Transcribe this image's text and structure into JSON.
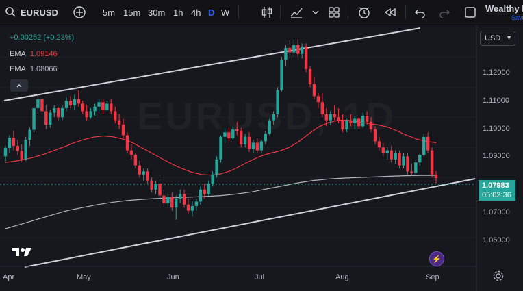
{
  "toolbar": {
    "symbol": "EURUSD",
    "intervals": [
      "5m",
      "15m",
      "30m",
      "1h",
      "4h",
      "D",
      "W"
    ],
    "active_interval": "D",
    "account_name": "Wealthy I",
    "account_sub": "Save"
  },
  "legend": {
    "change": "+0.00252 (+0.23%)",
    "change_color": "#26a69a",
    "ema1_label": "EMA",
    "ema1_value": "1.09146",
    "ema1_color": "#f23645",
    "ema2_label": "EMA",
    "ema2_value": "1.08066",
    "ema2_color": "#b2b5be"
  },
  "currency_select": "USD",
  "watermark": "EURUSD, 1D",
  "price_axis": {
    "ticks": [
      "1.12000",
      "1.11000",
      "1.10000",
      "1.09000",
      "1.07000",
      "1.06000"
    ],
    "current_price": "1.07983",
    "countdown": "05:02:36",
    "current_color": "#26a69a"
  },
  "time_axis": {
    "ticks": [
      "Apr",
      "May",
      "Jun",
      "Jul",
      "Aug",
      "Sep"
    ]
  },
  "chart_data": {
    "type": "candlestick",
    "ohlc": [
      [
        1.087,
        1.0905,
        1.085,
        1.0898
      ],
      [
        1.0898,
        1.094,
        1.088,
        1.0932
      ],
      [
        1.0932,
        1.0955,
        1.089,
        1.0905
      ],
      [
        1.0905,
        1.0925,
        1.0875,
        1.0888
      ],
      [
        1.0888,
        1.091,
        1.085,
        1.086
      ],
      [
        1.086,
        1.0935,
        1.0855,
        1.0925
      ],
      [
        1.0925,
        1.0965,
        1.0905,
        1.0958
      ],
      [
        1.0958,
        1.104,
        1.095,
        1.103
      ],
      [
        1.103,
        1.1075,
        1.101,
        1.106
      ],
      [
        1.106,
        1.107,
        1.101,
        1.102
      ],
      [
        1.102,
        1.104,
        1.096,
        1.0975
      ],
      [
        1.0975,
        1.1025,
        1.0965,
        1.1015
      ],
      [
        1.1015,
        1.104,
        1.1,
        1.103
      ],
      [
        1.103,
        1.1035,
        1.099,
        1.1
      ],
      [
        1.1,
        1.104,
        1.099,
        1.103
      ],
      [
        1.103,
        1.1065,
        1.102,
        1.1055
      ],
      [
        1.1055,
        1.107,
        1.103,
        1.104
      ],
      [
        1.104,
        1.1075,
        1.1025,
        1.106
      ],
      [
        1.106,
        1.109,
        1.1035,
        1.1045
      ],
      [
        1.1045,
        1.1055,
        1.101,
        1.102
      ],
      [
        1.102,
        1.104,
        1.099,
        1.1
      ],
      [
        1.1,
        1.103,
        1.0995,
        1.102
      ],
      [
        1.102,
        1.1045,
        1.1005,
        1.1035
      ],
      [
        1.1035,
        1.106,
        1.102,
        1.105
      ],
      [
        1.105,
        1.106,
        1.101,
        1.1025
      ],
      [
        1.1025,
        1.1055,
        1.102,
        1.1045
      ],
      [
        1.1045,
        1.106,
        1.101,
        1.102
      ],
      [
        1.102,
        1.1035,
        1.098,
        1.099
      ],
      [
        1.099,
        1.101,
        1.096,
        1.0975
      ],
      [
        1.0975,
        1.0995,
        1.093,
        1.094
      ],
      [
        1.094,
        1.095,
        1.088,
        1.089
      ],
      [
        1.089,
        1.091,
        1.086,
        1.0875
      ],
      [
        1.0875,
        1.088,
        1.083,
        1.084
      ],
      [
        1.084,
        1.0855,
        1.08,
        1.081
      ],
      [
        1.081,
        1.083,
        1.079,
        1.082
      ],
      [
        1.082,
        1.083,
        1.078,
        1.079
      ],
      [
        1.079,
        1.08,
        1.075,
        1.076
      ],
      [
        1.076,
        1.079,
        1.0745,
        1.078
      ],
      [
        1.078,
        1.0795,
        1.073,
        1.074
      ],
      [
        1.074,
        1.076,
        1.07,
        1.0715
      ],
      [
        1.0715,
        1.0745,
        1.0705,
        1.0735
      ],
      [
        1.0735,
        1.075,
        1.069,
        1.07
      ],
      [
        1.07,
        1.074,
        1.066,
        1.073
      ],
      [
        1.073,
        1.076,
        1.0715,
        1.0745
      ],
      [
        1.0745,
        1.076,
        1.07,
        1.071
      ],
      [
        1.071,
        1.073,
        1.068,
        1.069
      ],
      [
        1.069,
        1.072,
        1.067,
        1.0705
      ],
      [
        1.0705,
        1.073,
        1.069,
        1.072
      ],
      [
        1.072,
        1.077,
        1.071,
        1.076
      ],
      [
        1.076,
        1.078,
        1.073,
        1.0745
      ],
      [
        1.0745,
        1.079,
        1.074,
        1.078
      ],
      [
        1.078,
        1.082,
        1.077,
        1.081
      ],
      [
        1.081,
        1.087,
        1.08,
        1.086
      ],
      [
        1.086,
        1.094,
        1.085,
        1.0935
      ],
      [
        1.0935,
        1.0965,
        1.0915,
        1.095
      ],
      [
        1.095,
        1.0965,
        1.092,
        1.093
      ],
      [
        1.093,
        1.097,
        1.0925,
        1.096
      ],
      [
        1.096,
        1.0985,
        1.094,
        1.0955
      ],
      [
        1.0955,
        1.0965,
        1.09,
        1.091
      ],
      [
        1.091,
        1.0945,
        1.09,
        1.0935
      ],
      [
        1.0935,
        1.095,
        1.0885,
        1.0895
      ],
      [
        1.0895,
        1.0925,
        1.088,
        1.0915
      ],
      [
        1.0915,
        1.093,
        1.088,
        1.089
      ],
      [
        1.089,
        1.0925,
        1.088,
        1.092
      ],
      [
        1.092,
        1.0955,
        1.091,
        1.0945
      ],
      [
        1.0945,
        1.0995,
        1.094,
        1.099
      ],
      [
        1.099,
        1.102,
        1.0975,
        1.101
      ],
      [
        1.101,
        1.11,
        1.1,
        1.109
      ],
      [
        1.109,
        1.12,
        1.1085,
        1.119
      ],
      [
        1.119,
        1.124,
        1.117,
        1.123
      ],
      [
        1.123,
        1.1255,
        1.1195,
        1.1215
      ],
      [
        1.1215,
        1.126,
        1.12,
        1.124
      ],
      [
        1.124,
        1.126,
        1.12,
        1.121
      ],
      [
        1.121,
        1.1245,
        1.1195,
        1.1235
      ],
      [
        1.1235,
        1.1245,
        1.115,
        1.116
      ],
      [
        1.116,
        1.117,
        1.11,
        1.111
      ],
      [
        1.111,
        1.1135,
        1.106,
        1.107
      ],
      [
        1.107,
        1.108,
        1.103,
        1.105
      ],
      [
        1.105,
        1.108,
        1.1,
        1.101
      ],
      [
        1.101,
        1.103,
        1.097,
        1.099
      ],
      [
        1.099,
        1.102,
        1.0975,
        1.101
      ],
      [
        1.101,
        1.104,
        1.099,
        1.1
      ],
      [
        1.1,
        1.103,
        1.098,
        1.099
      ],
      [
        1.099,
        1.101,
        1.095,
        1.096
      ],
      [
        1.096,
        1.0995,
        1.095,
        1.099
      ],
      [
        1.099,
        1.101,
        1.097,
        1.098
      ],
      [
        1.098,
        1.1005,
        1.096,
        1.0995
      ],
      [
        1.0995,
        1.1,
        1.096,
        1.097
      ],
      [
        1.097,
        1.1015,
        1.0965,
        1.1005
      ],
      [
        1.1005,
        1.102,
        1.0975,
        1.0985
      ],
      [
        1.0985,
        1.1,
        1.095,
        1.096
      ],
      [
        1.096,
        1.097,
        1.091,
        1.092
      ],
      [
        1.092,
        1.0935,
        1.089,
        1.09
      ],
      [
        1.09,
        1.0915,
        1.087,
        1.088
      ],
      [
        1.088,
        1.09,
        1.086,
        1.089
      ],
      [
        1.089,
        1.0905,
        1.085,
        1.086
      ],
      [
        1.086,
        1.089,
        1.0845,
        1.088
      ],
      [
        1.088,
        1.089,
        1.083,
        1.084
      ],
      [
        1.084,
        1.088,
        1.083,
        1.087
      ],
      [
        1.087,
        1.088,
        1.081,
        1.082
      ],
      [
        1.082,
        1.0845,
        1.0805,
        1.0815
      ],
      [
        1.0815,
        1.086,
        1.081,
        1.085
      ],
      [
        1.085,
        1.088,
        1.084,
        1.0875
      ],
      [
        1.0875,
        1.0945,
        1.087,
        1.0935
      ],
      [
        1.0935,
        1.095,
        1.088,
        1.089
      ],
      [
        1.089,
        1.09,
        1.08,
        1.081
      ],
      [
        1.081,
        1.082,
        1.078,
        1.0798
      ]
    ],
    "ema_fast": [
      1.085,
      1.0854,
      1.086,
      1.0868,
      1.0878,
      1.089,
      1.0902,
      1.0915,
      1.0926,
      1.0934,
      1.0938,
      1.0935,
      1.0928,
      1.0915,
      1.0898,
      1.088,
      1.0862,
      1.0845,
      1.083,
      1.0818,
      1.081,
      1.0808,
      1.0812,
      1.0822,
      1.0838,
      1.0855,
      1.087,
      1.088,
      1.0888,
      1.09,
      1.092,
      1.0945,
      1.0968,
      1.0982,
      1.099,
      1.099,
      1.0985,
      1.098,
      1.0975,
      1.0968,
      1.0955,
      1.094,
      1.0928,
      1.092,
      1.0915
    ],
    "ema_slow": [
      1.063,
      1.0645,
      1.066,
      1.0675,
      1.069,
      1.07,
      1.071,
      1.0718,
      1.0724,
      1.0728,
      1.0731,
      1.0733,
      1.0735,
      1.0737,
      1.074,
      1.0745,
      1.0752,
      1.0762,
      1.0772,
      1.0782,
      1.079,
      1.0795,
      1.0798,
      1.08,
      1.0802,
      1.0804,
      1.0806,
      1.0807,
      1.0807
    ],
    "ylim": [
      1.0505,
      1.1305
    ],
    "ylabel": "",
    "xlabel": ""
  }
}
